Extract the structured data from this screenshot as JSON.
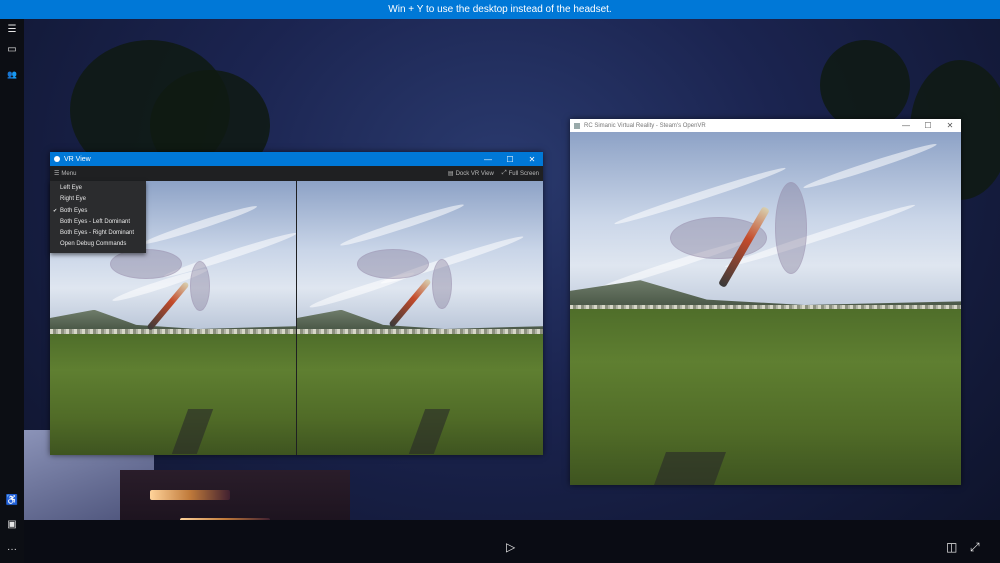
{
  "banner": {
    "text": "Win + Y to use the desktop instead of the headset."
  },
  "rail": {
    "top_items": [
      {
        "icon": "hamburger-menu-icon",
        "glyph": "☰"
      },
      {
        "icon": "headset-icon",
        "glyph": "▭"
      },
      {
        "icon": "people-icon",
        "glyph": "👥"
      }
    ],
    "bottom_items": [
      {
        "icon": "accessibility-icon",
        "glyph": "♿"
      },
      {
        "icon": "screenshot-icon",
        "glyph": "▣"
      },
      {
        "icon": "more-icon",
        "glyph": "···"
      }
    ]
  },
  "bottom_bar": {
    "play_glyph": "▷",
    "snap_glyph": "◫",
    "expand_glyph": "⤢"
  },
  "vr_window": {
    "title": "VR View",
    "title_icon": "vr-app-icon",
    "toolbar": {
      "menu_label": "Menu",
      "dock_label": "Dock VR View",
      "fullscreen_label": "Full Screen"
    },
    "menu": {
      "items": [
        {
          "label": "Left Eye",
          "checked": false
        },
        {
          "label": "Right Eye",
          "checked": false
        },
        {
          "label": "Both Eyes",
          "checked": true
        },
        {
          "label": "Both Eyes - Left Dominant",
          "checked": false
        },
        {
          "label": "Both Eyes - Right Dominant",
          "checked": false
        },
        {
          "label": "Open Debug Commands",
          "checked": false
        }
      ]
    }
  },
  "game_window": {
    "title": "RC Simanic Virtual Reality - Steam's OpenVR"
  },
  "caption_glyphs": {
    "minimize": "—",
    "maximize": "☐",
    "close": "✕"
  },
  "colors": {
    "banner": "#0078d7",
    "vr_titlebar": "#0078d7",
    "rail": "#0c0e14",
    "menu_bg": "#2b2c2e"
  }
}
